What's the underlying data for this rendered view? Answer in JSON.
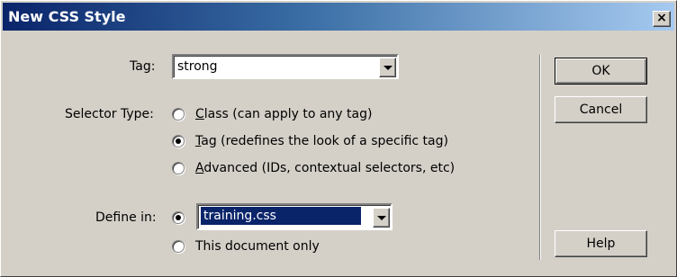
{
  "window": {
    "title": "New CSS Style",
    "close_label": "×"
  },
  "tag": {
    "label": "Tag:",
    "value": "strong"
  },
  "selector_type": {
    "label": "Selector Type:",
    "options": [
      {
        "mnemonic": "C",
        "rest": "lass (can apply to any tag)",
        "checked": false
      },
      {
        "mnemonic": "T",
        "rest": "ag (redefines the look of a specific tag)",
        "checked": true
      },
      {
        "mnemonic": "A",
        "rest": "dvanced (IDs, contextual selectors, etc)",
        "checked": false
      }
    ]
  },
  "define_in": {
    "label": "Define in:",
    "file_value": "training.css",
    "document_only_label": "This document only",
    "file_checked": true
  },
  "buttons": {
    "ok": "OK",
    "cancel": "Cancel",
    "help": "Help"
  }
}
